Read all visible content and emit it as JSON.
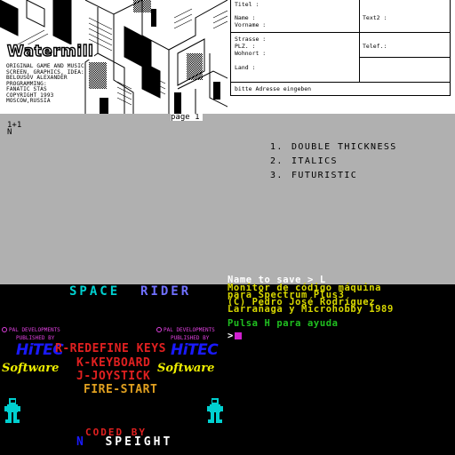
{
  "colors": {
    "grey": "#b0b0b0",
    "cyan": "#00d0d0",
    "magenta": "#e040e0",
    "blue": "#1a1aff",
    "yellow": "#f0f000",
    "red": "#e02020",
    "green": "#20c020",
    "monitor_yellow": "#d8d800"
  },
  "watermill": {
    "logo": "Watermill",
    "credits": [
      "ORIGINAL GAME AND MUSIC",
      "SCREEN, GRAPHICS, IDEA:",
      "BELOUSOV ALEXANDER",
      "PROGRAMMING:",
      "FANATIC STAS",
      "COPYRIGHT 1993",
      "MOSCOW,RUSSIA"
    ]
  },
  "form": {
    "titel": "Titel   :",
    "name": "Name    :",
    "vorname": "Vorname :",
    "strasse": "Strasse :",
    "plz": "PLZ.    :",
    "wohnort": "Wohnort :",
    "land": "Land    :",
    "text2": "Text2 :",
    "telef": "Telef.:",
    "prompt": "bitte Adresse eingeben"
  },
  "editor": {
    "page_label": "page 1",
    "line1": "1+1",
    "line2": "N",
    "menu": [
      {
        "num": "1.",
        "label": "DOUBLE THICKNESS"
      },
      {
        "num": "2.",
        "label": "ITALICS"
      },
      {
        "num": "3.",
        "label": "FUTURISTIC"
      }
    ]
  },
  "game": {
    "title_a": "SPACE",
    "title_b": "RIDER",
    "pal_left": "PAL DEVELOPMENTS",
    "pub_left": "PUBLISHED BY",
    "pal_right": "PAL DEVELOPMENTS",
    "pub_right": "PUBLISHED BY",
    "hitec": "HiTEC",
    "software": "Software",
    "options": [
      {
        "text": "R-REDEFINE  KEYS",
        "color": "#e02020"
      },
      {
        "text": "K-KEYBOARD",
        "color": "#e02020"
      },
      {
        "text": "J-JOYSTICK",
        "color": "#e02020"
      },
      {
        "text": "FIRE-START",
        "color": "#e0a020"
      }
    ],
    "coded_by": "CODED BY",
    "author_initial": "N",
    "author_name": "SPEIGHT"
  },
  "monitor": {
    "save_prompt": "Name to save > L",
    "title1": "Monitor de código máquina",
    "title2": "para Spectrum Plus3",
    "copyright": "(C) Pedro José Rodríguez",
    "company": "Larrañaga y Microhobby 1989",
    "help": "Pulsa H para ayuda",
    "prompt": ">"
  }
}
